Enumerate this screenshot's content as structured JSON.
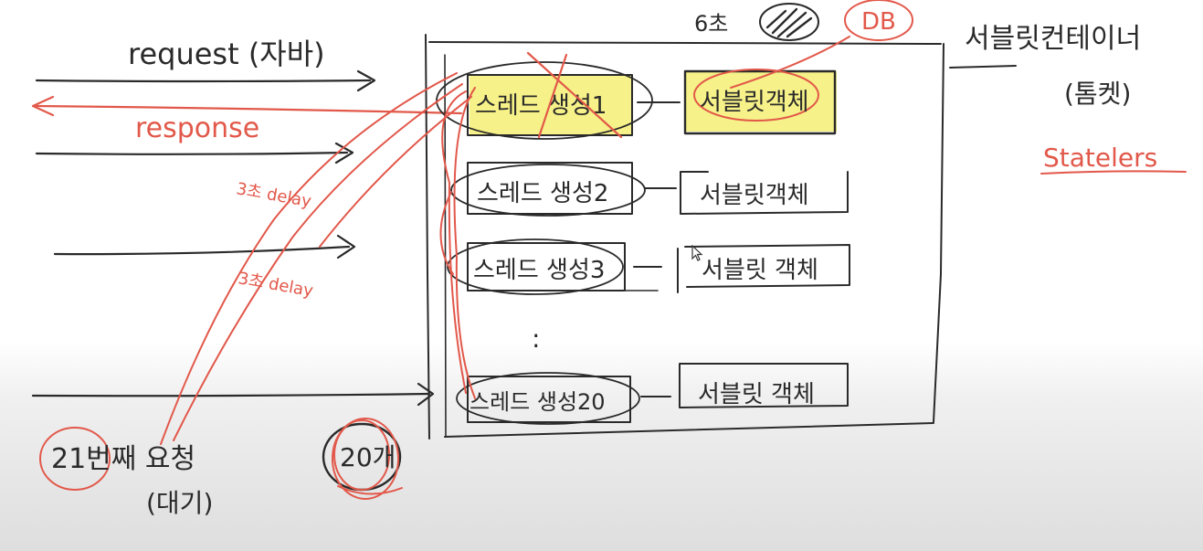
{
  "colors": {
    "ink": "#2a2a2a",
    "red": "#e2584a",
    "highlight": "#f4ef73"
  },
  "arrows": {
    "request_label": "request (자바)",
    "response_label": "response",
    "delay_1": "3초 delay",
    "delay_2": "3초 delay"
  },
  "container": {
    "top_label_time": "6초",
    "db_label": "DB",
    "name_label": "서블릿컨테이너",
    "singleton_label": "(톰켓)",
    "stateless_label": "Statelers"
  },
  "threads": [
    {
      "label": "스레드 생성1"
    },
    {
      "label": "스레드 생성2"
    },
    {
      "label": "스레드 생성3"
    },
    {
      "label": "스레드 생성20"
    }
  ],
  "servlets": [
    {
      "label": "서블릿객체"
    },
    {
      "label": "서블릿객체"
    },
    {
      "label": "서블릿 객체"
    },
    {
      "label": "서블릿 객체"
    }
  ],
  "ellipsis": ":",
  "bottom": {
    "request_21": "21번째 요청",
    "waiting": "(대기)",
    "count_20": "20개"
  },
  "cursor_icon": "arrow-pointer-icon"
}
